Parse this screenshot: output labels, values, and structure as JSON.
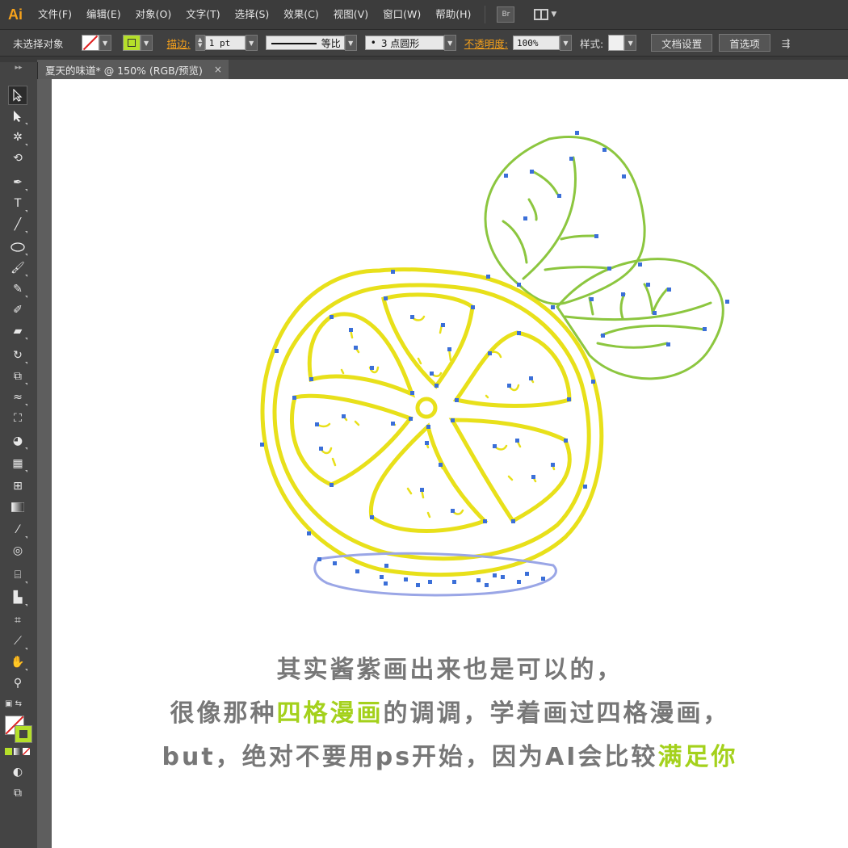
{
  "app": {
    "logo": "Ai"
  },
  "menu": [
    "文件(F)",
    "编辑(E)",
    "对象(O)",
    "文字(T)",
    "选择(S)",
    "效果(C)",
    "视图(V)",
    "窗口(W)",
    "帮助(H)"
  ],
  "bridge_label": "Br",
  "control": {
    "selection_label": "未选择对象",
    "stroke_label": "描边:",
    "stroke_weight": "1 pt",
    "profile_label": "等比",
    "brush_label": "3 点圆形",
    "opacity_label": "不透明度:",
    "opacity_value": "100%",
    "style_label": "样式:",
    "doc_setup": "文档设置",
    "preferences": "首选项"
  },
  "document_tab": {
    "title": "夏天的味道* @ 150% (RGB/预览)",
    "close": "×"
  },
  "caption": {
    "line1": "其实酱紫画出来也是可以的，",
    "line2_a": "很像那种",
    "line2_hl": "四格漫画",
    "line2_b": "的调调，学着画过四格漫画，",
    "line3_a": "but，绝对不要用ps开始，因为AI会比较",
    "line3_hl": "满足你"
  },
  "colors": {
    "accent": "#a4d11c",
    "lemon_stroke": "#e8e01a",
    "leaf_stroke": "#8cc63f",
    "anchor": "#3b6fd8",
    "plate": "#9aa6e6"
  }
}
